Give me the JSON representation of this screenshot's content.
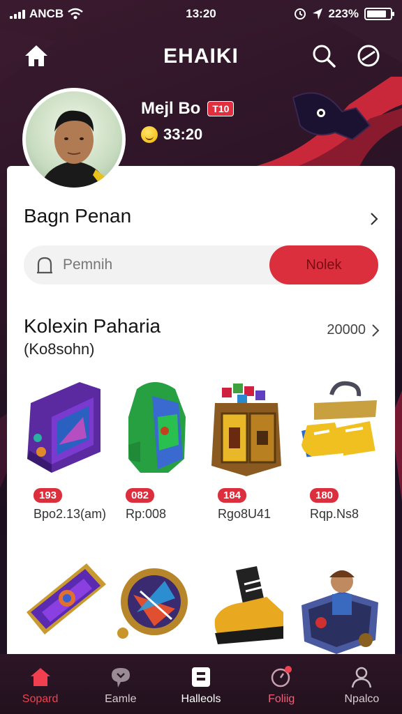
{
  "status_bar": {
    "carrier": "ANCB",
    "time": "13:20",
    "battery": "223%",
    "battery_level": 0.85
  },
  "header": {
    "title": "EHAIKI"
  },
  "profile": {
    "name": "Mejl Bo",
    "badge": "T10",
    "coins": "33:20"
  },
  "section": {
    "title": "Bagn Penan"
  },
  "search": {
    "placeholder": "Pemnih",
    "button_label": "Nolek"
  },
  "collection": {
    "title": "Kolexin Paharia",
    "subtitle": "(Ko8sohn)",
    "count": "20000",
    "items": [
      {
        "price": "193",
        "name": "Bpo2.13(am)",
        "icon": "arcade-box-icon"
      },
      {
        "price": "082",
        "name": "Rp:008",
        "icon": "green-armor-icon"
      },
      {
        "price": "184",
        "name": "Rgo8U41",
        "icon": "treasure-chest-icon"
      },
      {
        "price": "180",
        "name": "Rqp.Ns8",
        "icon": "yellow-sneakers-icon"
      },
      {
        "price": "",
        "name": "",
        "icon": "purple-card-icon"
      },
      {
        "price": "",
        "name": "",
        "icon": "magic-orb-icon"
      },
      {
        "price": "",
        "name": "",
        "icon": "yellow-boot-icon"
      },
      {
        "price": "",
        "name": "",
        "icon": "toy-crate-icon"
      }
    ]
  },
  "bottom_nav": [
    {
      "label": "Sopard",
      "icon": "home-icon",
      "active": true
    },
    {
      "label": "Eamle",
      "icon": "chat-icon",
      "active": false
    },
    {
      "label": "Halleols",
      "icon": "bag-icon",
      "active": false
    },
    {
      "label": "Foliig",
      "icon": "notification-icon",
      "active": false
    },
    {
      "label": "Npalco",
      "icon": "profile-icon",
      "active": false
    }
  ],
  "colors": {
    "accent": "#dc2f3d",
    "header_bg": "#2a1422",
    "card_bg": "#ffffff"
  }
}
